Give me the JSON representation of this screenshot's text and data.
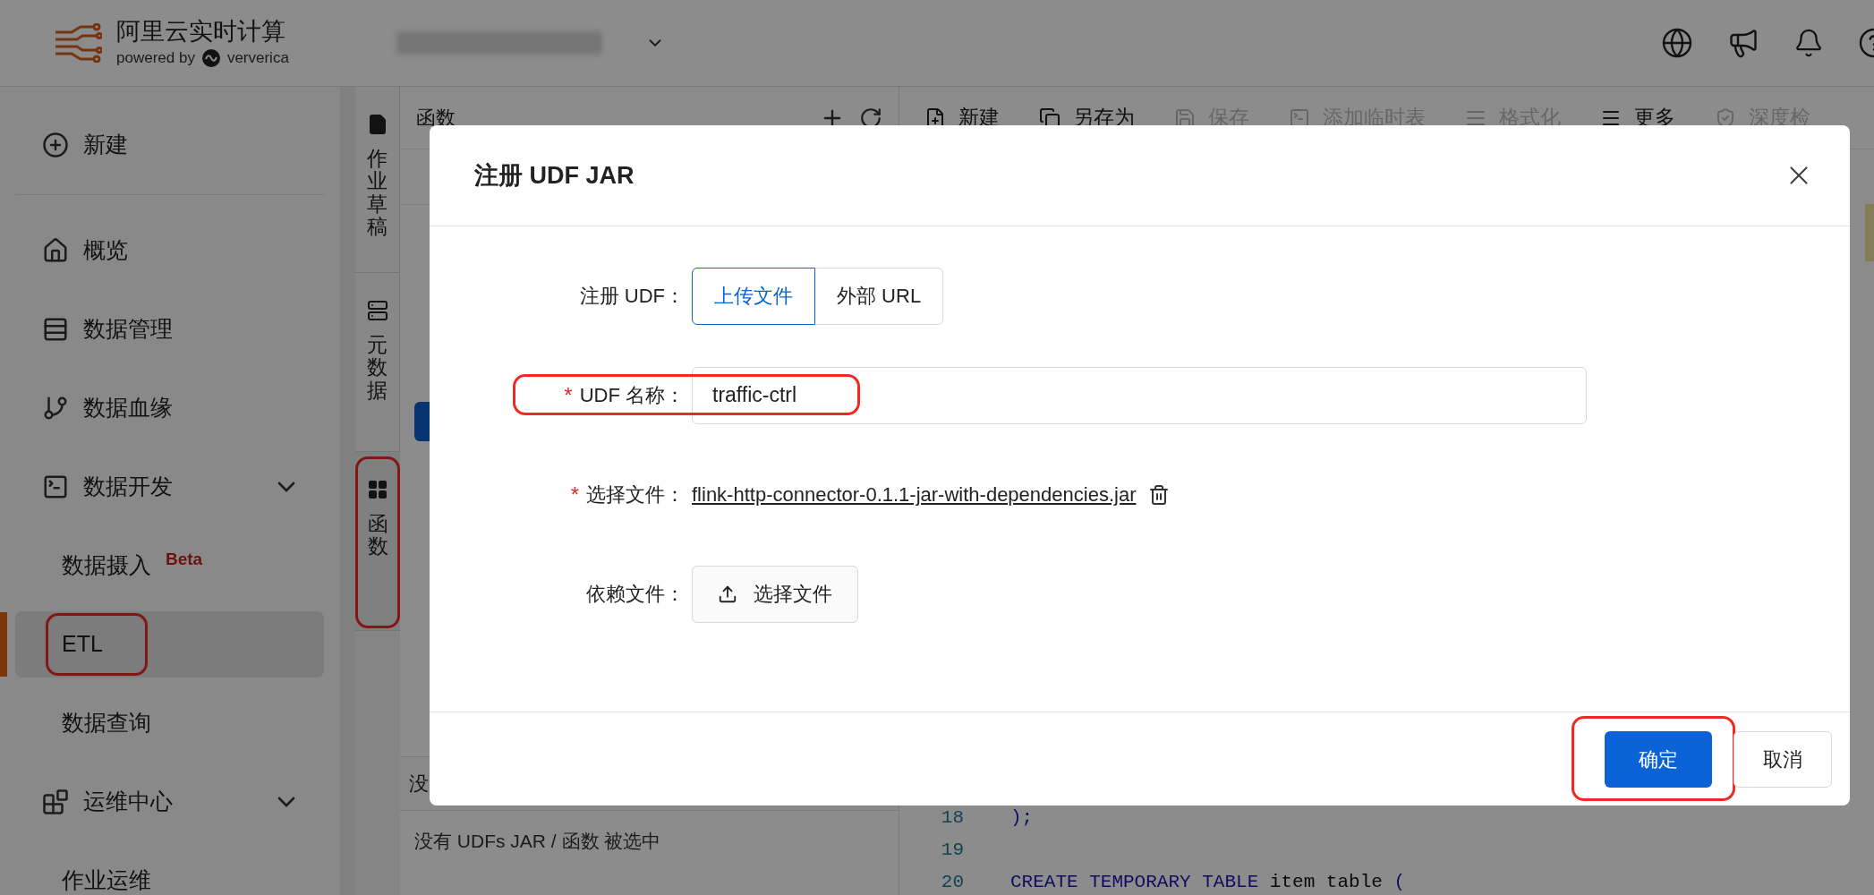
{
  "header": {
    "product_name": "阿里云实时计算",
    "powered_by": "powered by",
    "partner": "ververica"
  },
  "sidebar": {
    "items": [
      {
        "label": "新建",
        "selected": false,
        "highlighted": false
      },
      {
        "label": "概览",
        "selected": false,
        "highlighted": false
      },
      {
        "label": "数据管理",
        "selected": false,
        "highlighted": false
      },
      {
        "label": "数据血缘",
        "selected": false,
        "highlighted": false
      },
      {
        "label": "数据开发",
        "selected": false,
        "highlighted": false,
        "expanded": true,
        "children": [
          {
            "label": "数据摄入",
            "badge": "Beta",
            "selected": false,
            "highlighted": false
          },
          {
            "label": "ETL",
            "selected": true,
            "highlighted": true
          },
          {
            "label": "数据查询",
            "selected": false,
            "highlighted": false
          }
        ]
      },
      {
        "label": "运维中心",
        "selected": false,
        "highlighted": false,
        "expanded": true,
        "children": [
          {
            "label": "作业运维",
            "selected": false,
            "highlighted": false
          }
        ]
      }
    ]
  },
  "side_tabs": [
    {
      "label": "作业草稿",
      "selected": false,
      "highlighted": false
    },
    {
      "label": "元数据",
      "selected": false,
      "highlighted": false
    },
    {
      "label": "函数",
      "selected": true,
      "highlighted": true
    }
  ],
  "functions_panel": {
    "title": "函数",
    "section_title": "没",
    "empty_text": "没有 UDFs JAR / 函数 被选中"
  },
  "toolbar": [
    {
      "label": "新建",
      "disabled": false
    },
    {
      "label": "另存为",
      "disabled": false
    },
    {
      "label": "保存",
      "disabled": true
    },
    {
      "label": "添加临时表",
      "disabled": true
    },
    {
      "label": "格式化",
      "disabled": true
    },
    {
      "label": "更多",
      "disabled": false
    },
    {
      "label": "深度检",
      "disabled": true
    }
  ],
  "code_lines": [
    {
      "number": "18",
      "tokens": [
        {
          "text": ");",
          "kind": "punct"
        }
      ]
    },
    {
      "number": "19"
    },
    {
      "number": "20",
      "tokens": [
        {
          "text": "CREATE TEMPORARY TABLE",
          "kind": "keyword"
        },
        {
          "text": " item table ",
          "kind": "plain"
        },
        {
          "text": "(",
          "kind": "punct"
        }
      ]
    }
  ],
  "dialog": {
    "title": "注册 UDF JAR",
    "fields": [
      {
        "kind": "segmented",
        "label": "注册 UDF：",
        "highlighted": false,
        "options": [
          {
            "label": "上传文件",
            "selected": true
          },
          {
            "label": "外部 URL",
            "selected": false
          }
        ]
      },
      {
        "kind": "input",
        "label": "UDF 名称：",
        "required_mark": "*",
        "highlighted": true,
        "value": "traffic-ctrl"
      },
      {
        "kind": "file",
        "label": "选择文件：",
        "required_mark": "*",
        "highlighted": false,
        "file_name": "flink-http-connector-0.1.1-jar-with-dependencies.jar"
      },
      {
        "kind": "upload",
        "label": "依赖文件：",
        "highlighted": false,
        "button": "选择文件"
      }
    ],
    "buttons": [
      {
        "label": "确定",
        "primary": true,
        "highlighted": true
      },
      {
        "label": "取消",
        "primary": false,
        "highlighted": false
      }
    ]
  }
}
